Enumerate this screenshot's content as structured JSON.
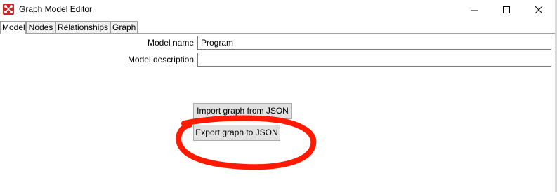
{
  "window": {
    "title": "Graph Model Editor"
  },
  "tabs": [
    {
      "label": "Model",
      "active": true
    },
    {
      "label": "Nodes",
      "active": false
    },
    {
      "label": "Relationships",
      "active": false
    },
    {
      "label": "Graph",
      "active": false
    }
  ],
  "form": {
    "model_name_label": "Model name",
    "model_name_value": "Program",
    "model_description_label": "Model description",
    "model_description_value": ""
  },
  "buttons": {
    "import_label": "Import graph from JSON",
    "export_label": "Export graph to JSON"
  },
  "colors": {
    "annotation": "#ff1a00",
    "app_icon": "#c62828"
  },
  "icons": {
    "app": "graph-app-icon",
    "minimize": "minimize-icon",
    "maximize": "maximize-icon",
    "close": "close-icon"
  }
}
